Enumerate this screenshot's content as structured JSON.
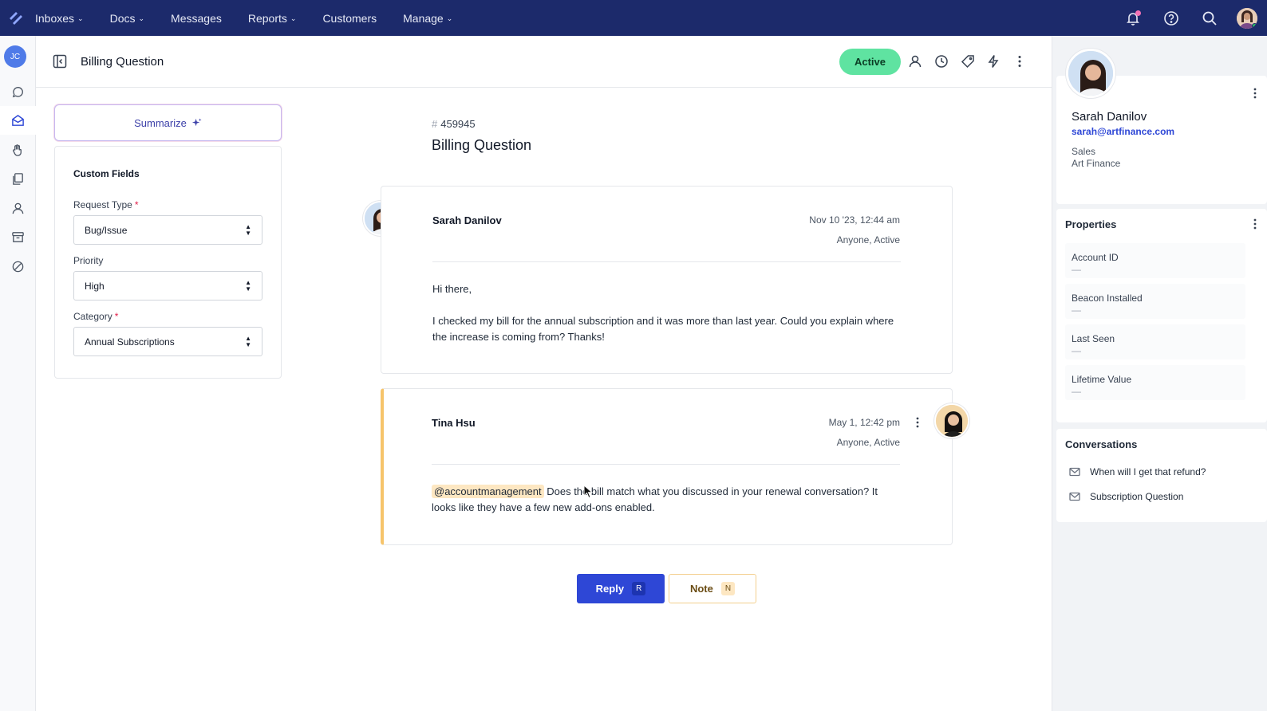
{
  "nav": {
    "items": [
      {
        "label": "Inboxes",
        "has_menu": true
      },
      {
        "label": "Docs",
        "has_menu": true
      },
      {
        "label": "Messages",
        "has_menu": false
      },
      {
        "label": "Reports",
        "has_menu": true
      },
      {
        "label": "Customers",
        "has_menu": false
      },
      {
        "label": "Manage",
        "has_menu": true
      }
    ],
    "chevron": "⌄",
    "icons": [
      "bell-icon",
      "help-icon",
      "search-icon"
    ]
  },
  "rail": {
    "user_initials": "JC",
    "icons": [
      "chat-icon",
      "inbox-icon",
      "hand-icon",
      "docs-icon",
      "person-icon",
      "archive-icon",
      "spam-icon"
    ]
  },
  "header": {
    "title": "Billing Question",
    "status": "Active",
    "icons": [
      "assign-icon",
      "snooze-icon",
      "tag-icon",
      "workflow-icon",
      "more-icon"
    ]
  },
  "left_panel": {
    "summarize_label": "Summarize",
    "custom_fields_title": "Custom Fields",
    "fields": [
      {
        "label": "Request Type",
        "required": "*",
        "value": "Bug/Issue"
      },
      {
        "label": "Priority",
        "required": "",
        "value": "High"
      },
      {
        "label": "Category",
        "required": "*",
        "value": "Annual Subscriptions"
      }
    ]
  },
  "conversation": {
    "hash": "#",
    "number": "459945",
    "title": "Billing Question",
    "threads": [
      {
        "author": "Sarah Danilov",
        "date": "Nov 10 '23, 12:44 am",
        "meta": "Anyone, Active",
        "greeting": "Hi there,",
        "body": "I checked my bill for the annual subscription and it was more than last year. Could you explain where the increase is coming from? Thanks!"
      },
      {
        "author": "Tina Hsu",
        "date": "May 1, 12:42 pm",
        "meta": "Anyone, Active",
        "mention": "@accountmanagement",
        "body": "Does the bill match what you discussed in your renewal conversation? It looks like they have a few new add-ons enabled."
      }
    ],
    "reply_label": "Reply",
    "reply_key": "R",
    "note_label": "Note",
    "note_key": "N"
  },
  "customer": {
    "name": "Sarah Danilov",
    "email": "sarah@artfinance.com",
    "department": "Sales",
    "company": "Art Finance"
  },
  "properties": {
    "title": "Properties",
    "items": [
      {
        "label": "Account ID",
        "value": "—"
      },
      {
        "label": "Beacon Installed",
        "value": "—"
      },
      {
        "label": "Last Seen",
        "value": "—"
      },
      {
        "label": "Lifetime Value",
        "value": "—"
      }
    ]
  },
  "past_conversations": {
    "title": "Conversations",
    "items": [
      "When will I get that refund?",
      "Subscription Question"
    ]
  },
  "colors": {
    "nav_bg": "#1c2a6b",
    "accent": "#2e47d6",
    "active_status": "#5fe3a1",
    "note_accent": "#f6c46b"
  }
}
